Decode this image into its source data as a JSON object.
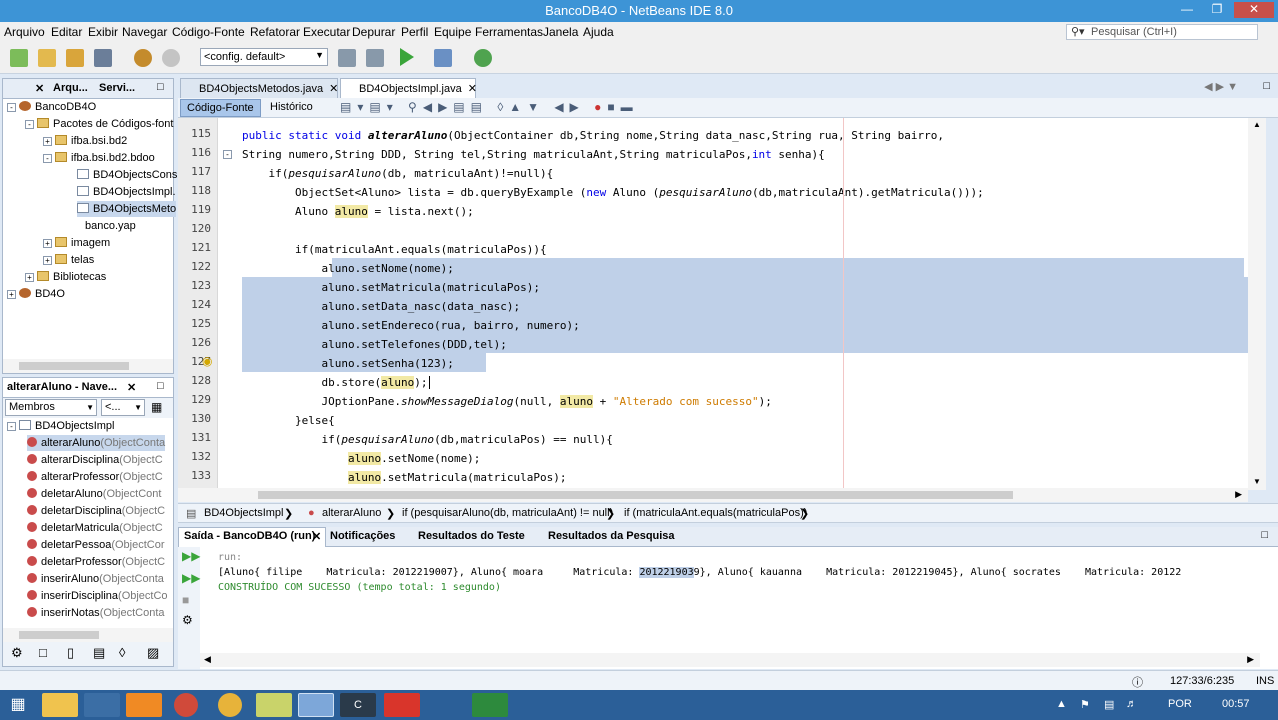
{
  "window": {
    "title": "BancoDB4O - NetBeans IDE 8.0"
  },
  "menu": [
    "Arquivo",
    "Editar",
    "Exibir",
    "Navegar",
    "Código-Fonte",
    "Refatorar",
    "Executar",
    "Depurar",
    "Perfil",
    "Equipe",
    "Ferramentas",
    "Janela",
    "Ajuda"
  ],
  "search": {
    "placeholder": "Pesquisar (Ctrl+I)"
  },
  "toolbar": {
    "config": "<config. default>"
  },
  "projects": {
    "tabs": [
      "Arqu...",
      "Servi..."
    ],
    "items": [
      "BancoDB4O",
      "Pacotes de Códigos-font",
      "ifba.bsi.bd2",
      "ifba.bsi.bd2.bdoo",
      "BD4ObjectsCons",
      "BD4ObjectsImpl.",
      "BD4ObjectsMeto",
      "banco.yap",
      "imagem",
      "telas",
      "Bibliotecas",
      "BD4O"
    ]
  },
  "navigator": {
    "title": "alterarAluno - Nave...",
    "filter": "Membros",
    "filter2": "<...",
    "root": "BD4ObjectsImpl",
    "members": [
      {
        "name": "alterarAluno",
        "sig": "(ObjectConta"
      },
      {
        "name": "alterarDisciplina",
        "sig": "(ObjectC"
      },
      {
        "name": "alterarProfessor",
        "sig": "(ObjectC"
      },
      {
        "name": "deletarAluno",
        "sig": "(ObjectCont"
      },
      {
        "name": "deletarDisciplina",
        "sig": "(ObjectC"
      },
      {
        "name": "deletarMatricula",
        "sig": "(ObjectC"
      },
      {
        "name": "deletarPessoa",
        "sig": "(ObjectCor"
      },
      {
        "name": "deletarProfessor",
        "sig": "(ObjectC"
      },
      {
        "name": "inserirAluno",
        "sig": "(ObjectConta"
      },
      {
        "name": "inserirDisciplina",
        "sig": "(ObjectCo"
      },
      {
        "name": "inserirNotas",
        "sig": "(ObjectConta"
      }
    ]
  },
  "editor": {
    "tabs": [
      "BD4ObjectsMetodos.java",
      "BD4ObjectsImpl.java"
    ],
    "source_label": "Código-Fonte",
    "history_label": "Histórico",
    "line_numbers": [
      "115",
      "116",
      "117",
      "118",
      "119",
      "120",
      "121",
      "122",
      "123",
      "124",
      "125",
      "126",
      "127",
      "128",
      "129",
      "130",
      "131",
      "132",
      "133"
    ],
    "lines": {
      "l115": {
        "a": "public static void ",
        "b": "alterarAluno",
        "c": "(ObjectContainer db,String nome,String data_nasc,String rua, String bairro,"
      },
      "l116": {
        "a": "String numero,String DDD, String tel,String matriculaAnt,String matriculaPos,",
        "b": "int",
        "c": " senha){"
      },
      "l117": {
        "a": "    if(",
        "b": "pesquisarAluno",
        "c": "(db, matriculaAnt)!=null){"
      },
      "l118": {
        "a": "        ObjectSet<Aluno> lista = db.queryByExample (",
        "b": "new",
        "c": " Aluno (",
        "d": "pesquisarAluno",
        "e": "(db,matriculaAnt).getMatricula()));"
      },
      "l119": {
        "a": "        Aluno ",
        "b": "aluno",
        "c": " = lista.next();"
      },
      "l120": "",
      "l121": "        if(matriculaAnt.equals(matriculaPos)){",
      "l122": "            aluno.setNome(nome);",
      "l123": "            aluno.setMatricula(matriculaPos);",
      "l124": "            aluno.setData_nasc(data_nasc);",
      "l125": "            aluno.setEndereco(rua, bairro, numero);",
      "l126": "            aluno.setTelefones(DDD,tel);",
      "l127": "            aluno.setSenha(123);",
      "l128": {
        "a": "            db.store(",
        "b": "aluno",
        "c": ");"
      },
      "l129": {
        "a": "            JOptionPane.",
        "b": "showMessageDialog",
        "c": "(null, ",
        "d": "aluno",
        "e": " + ",
        "f": "\"Alterado com sucesso\"",
        "g": ");"
      },
      "l130": "        }else{",
      "l131": {
        "a": "            if(",
        "b": "pesquisarAluno",
        "c": "(db,matriculaPos) == null){"
      },
      "l132": {
        "a": "                ",
        "b": "aluno",
        "c": ".setNome(nome);"
      },
      "l133": {
        "a": "                ",
        "b": "aluno",
        "c": ".setMatricula(matriculaPos);"
      }
    }
  },
  "breadcrumb": [
    "BD4ObjectsImpl",
    "alterarAluno",
    "if (pesquisarAluno(db, matriculaAnt) != null)",
    "if (matriculaAnt.equals(matriculaPos))"
  ],
  "output": {
    "tabs": [
      "Saída - BancoDB4O (run)",
      "Notificações",
      "Resultados do Teste",
      "Resultados da Pesquisa"
    ],
    "run": "run:",
    "line1a": "[Aluno{ filipe    Matricula: 2012219007}, Aluno{ moara     Matricula: ",
    "line1sel": "201221903",
    "line1b": "9}, Aluno{ kauanna    Matricula: 2012219045}, Aluno{ socrates    Matricula: 20122",
    "build": "CONSTRUÍDO COM SUCESSO (tempo total: 1 segundo)"
  },
  "status": {
    "position": "127:33/6:235",
    "mode": "INS"
  },
  "taskbar": {
    "lang": "POR",
    "time": "00:57"
  }
}
